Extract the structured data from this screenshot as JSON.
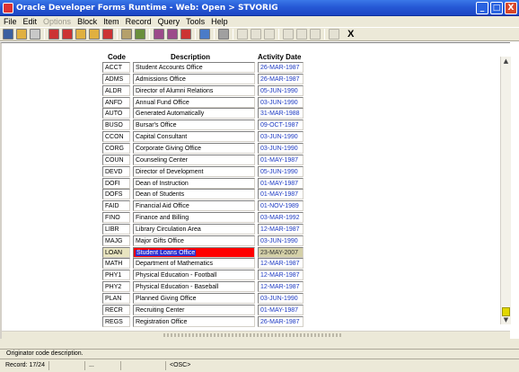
{
  "window": {
    "title": "Oracle Developer Forms Runtime - Web:  Open > STVORIG",
    "buttons": [
      "_",
      "□",
      "X"
    ]
  },
  "menu": [
    {
      "label": "File",
      "disabled": false
    },
    {
      "label": "Edit",
      "disabled": false
    },
    {
      "label": "Options",
      "disabled": true
    },
    {
      "label": "Block",
      "disabled": false
    },
    {
      "label": "Item",
      "disabled": false
    },
    {
      "label": "Record",
      "disabled": false
    },
    {
      "label": "Query",
      "disabled": false
    },
    {
      "label": "Tools",
      "disabled": false
    },
    {
      "label": "Help",
      "disabled": false
    }
  ],
  "toolbar": {
    "icons": [
      "save-icon",
      "rollback-icon",
      "print-icon",
      "first-record-icon",
      "prev-block-icon",
      "prev-record-icon",
      "next-record-icon",
      "next-block-icon",
      "enter-query-icon",
      "execute-query-icon",
      "insert-record-icon",
      "remove-record-icon",
      "clear-record-icon",
      "lock-record-icon",
      "print-icon",
      "cut-icon",
      "copy-icon",
      "paste-icon",
      "list-values-icon",
      "edit-icon",
      "display-error-icon",
      "help-icon",
      "exit-icon"
    ],
    "exit_label": "X"
  },
  "columns": {
    "code": "Code",
    "description": "Description",
    "activity_date": "Activity Date"
  },
  "rows": [
    {
      "code": "ACCT",
      "description": "Student Accounts Office",
      "date": "26-MAR-1987"
    },
    {
      "code": "ADMS",
      "description": "Admissions Office",
      "date": "26-MAR-1987"
    },
    {
      "code": "ALDR",
      "description": "Director of Alumni Relations",
      "date": "05-JUN-1990"
    },
    {
      "code": "ANFD",
      "description": "Annual Fund Office",
      "date": "03-JUN-1990"
    },
    {
      "code": "AUTO",
      "description": "Generated Automatically",
      "date": "31-MAR-1988"
    },
    {
      "code": "BUSO",
      "description": "Bursar's Office",
      "date": "09-OCT-1987"
    },
    {
      "code": "CCON",
      "description": "Capital Consultant",
      "date": "03-JUN-1990"
    },
    {
      "code": "CORG",
      "description": "Corporate Giving Office",
      "date": "03-JUN-1990"
    },
    {
      "code": "COUN",
      "description": "Counseling Center",
      "date": "01-MAY-1987"
    },
    {
      "code": "DEVD",
      "description": "Director of Development",
      "date": "05-JUN-1990"
    },
    {
      "code": "DOFI",
      "description": "Dean of Instruction",
      "date": "01-MAY-1987"
    },
    {
      "code": "DOFS",
      "description": "Dean of Students",
      "date": "01-MAY-1987"
    },
    {
      "code": "FAID",
      "description": "Financial Aid Office",
      "date": "01-NOV-1989"
    },
    {
      "code": "FINO",
      "description": "Finance and Billing",
      "date": "03-MAR-1992"
    },
    {
      "code": "LIBR",
      "description": "Library Circulation Area",
      "date": "12-MAR-1987"
    },
    {
      "code": "MAJG",
      "description": "Major Gifts Office",
      "date": "03-JUN-1990"
    },
    {
      "code": "LOAN",
      "description": "Student Loans Office",
      "date": "23-MAY-2007",
      "selected": true
    },
    {
      "code": "MATH",
      "description": "Department of Mathematics",
      "date": "12-MAR-1987"
    },
    {
      "code": "PHY1",
      "description": "Physical Education - Football",
      "date": "12-MAR-1987"
    },
    {
      "code": "PHY2",
      "description": "Physical Education - Baseball",
      "date": "12-MAR-1987"
    },
    {
      "code": "PLAN",
      "description": "Planned Giving Office",
      "date": "03-JUN-1990"
    },
    {
      "code": "RECR",
      "description": "Recruiting Center",
      "date": "01-MAY-1987"
    },
    {
      "code": "REGS",
      "description": "Registration Office",
      "date": "26-MAR-1987"
    }
  ],
  "hint": "Originator code description.",
  "status": {
    "record": "Record: 17/24",
    "segments": [
      "...",
      "",
      "<OSC>"
    ]
  },
  "colors": {
    "selected_bg": "#ff0000",
    "highlight_text_bg": "#2d2fd0",
    "date_text": "#1b38c2",
    "scroll_thumb": "#e2d800"
  }
}
